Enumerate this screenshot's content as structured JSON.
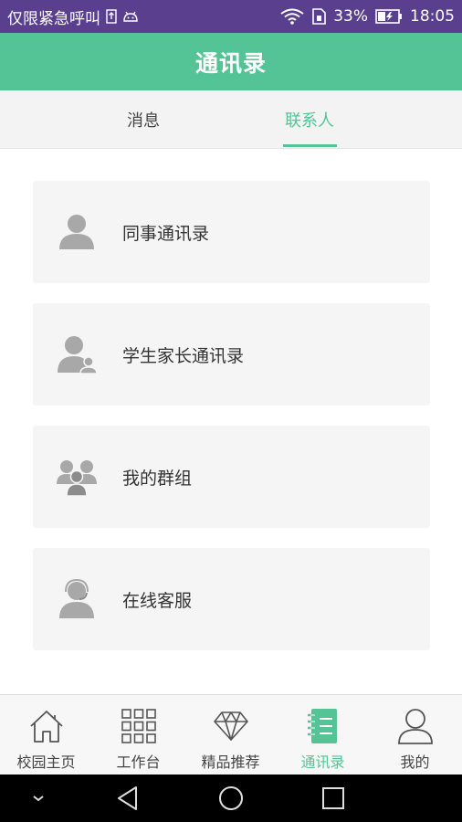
{
  "status_bar": {
    "emergency_text": "仅限紧急呼叫",
    "battery_percent": "33%",
    "time": "18:05",
    "icons": [
      "sim-icon",
      "android-debug-icon",
      "wifi-icon",
      "sim-card-icon",
      "battery-icon"
    ]
  },
  "header": {
    "title": "通讯录"
  },
  "tabs": [
    {
      "label": "消息",
      "active": false
    },
    {
      "label": "联系人",
      "active": true
    }
  ],
  "contacts": [
    {
      "label": "同事通讯录",
      "icon": "person-icon"
    },
    {
      "label": "学生家长通讯录",
      "icon": "parent-child-icon"
    },
    {
      "label": "我的群组",
      "icon": "group-icon"
    },
    {
      "label": "在线客服",
      "icon": "headset-agent-icon"
    }
  ],
  "bottom_nav": [
    {
      "label": "校园主页",
      "icon": "home-icon",
      "active": false
    },
    {
      "label": "工作台",
      "icon": "grid-icon",
      "active": false
    },
    {
      "label": "精品推荐",
      "icon": "diamond-icon",
      "active": false
    },
    {
      "label": "通讯录",
      "icon": "contacts-book-icon",
      "active": true
    },
    {
      "label": "我的",
      "icon": "profile-icon",
      "active": false
    }
  ],
  "system_nav": [
    "collapse-icon",
    "back-icon",
    "home-circle-icon",
    "recents-icon"
  ],
  "colors": {
    "accent": "#54c497",
    "status_bar": "#5a3f8e",
    "icon_gray": "#a8a8a8"
  }
}
